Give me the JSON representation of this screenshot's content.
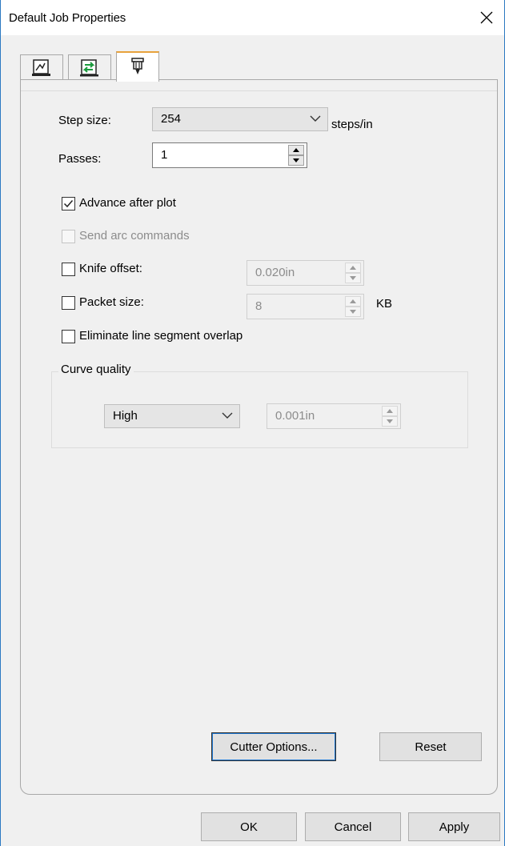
{
  "window": {
    "title": "Default Job Properties"
  },
  "tabs": [
    {
      "name": "tab-page",
      "icon": "page-layout-icon",
      "active": false
    },
    {
      "name": "tab-media",
      "icon": "media-advance-icon",
      "active": false
    },
    {
      "name": "tab-cutter",
      "icon": "knife-cutter-icon",
      "active": true
    }
  ],
  "step_size": {
    "label": "Step size:",
    "value": "254",
    "unit": "steps/in"
  },
  "passes": {
    "label": "Passes:",
    "value": "1"
  },
  "advance_after_plot": {
    "label": "Advance after plot",
    "checked": true
  },
  "send_arc_commands": {
    "label": "Send arc commands",
    "checked": false,
    "enabled": false
  },
  "knife_offset": {
    "label": "Knife offset:",
    "checked": false,
    "value": "0.020in"
  },
  "packet_size": {
    "label": "Packet size:",
    "checked": false,
    "value": "8",
    "unit": "KB"
  },
  "eliminate_overlap": {
    "label": "Eliminate line segment overlap",
    "checked": false
  },
  "curve_quality": {
    "group_label": "Curve quality",
    "level": "High",
    "tolerance": "0.001in"
  },
  "buttons": {
    "cutter_options": "Cutter Options...",
    "reset": "Reset",
    "ok": "OK",
    "cancel": "Cancel",
    "apply": "Apply"
  },
  "colors": {
    "focus_blue": "#1c76d2",
    "tab_accent": "#e8a23c",
    "window_border": "#2b79c2"
  }
}
